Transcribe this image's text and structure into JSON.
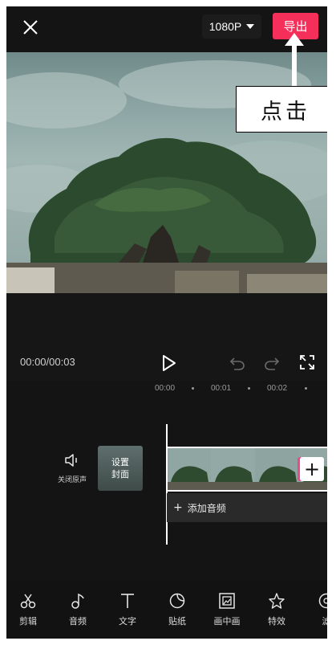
{
  "topbar": {
    "resolution": "1080P",
    "export_label": "导出"
  },
  "annotation": {
    "text": "点击"
  },
  "player": {
    "timecode": "00:00/00:03"
  },
  "ruler": {
    "ticks": [
      "00:00",
      "00:01",
      "00:02"
    ]
  },
  "timeline": {
    "mute_label": "关闭原声",
    "cover_label_line1": "设置",
    "cover_label_line2": "封面",
    "add_audio_label": "添加音频"
  },
  "toolbar": {
    "items": [
      {
        "label": "剪辑",
        "icon": "scissors-icon"
      },
      {
        "label": "音频",
        "icon": "music-note-icon"
      },
      {
        "label": "文字",
        "icon": "text-icon"
      },
      {
        "label": "贴纸",
        "icon": "sticker-icon"
      },
      {
        "label": "画中画",
        "icon": "picture-in-picture-icon"
      },
      {
        "label": "特效",
        "icon": "effects-star-icon"
      },
      {
        "label": "滤",
        "icon": "filter-icon"
      }
    ]
  },
  "colors": {
    "accent": "#f42f5a",
    "background": "#141414"
  }
}
